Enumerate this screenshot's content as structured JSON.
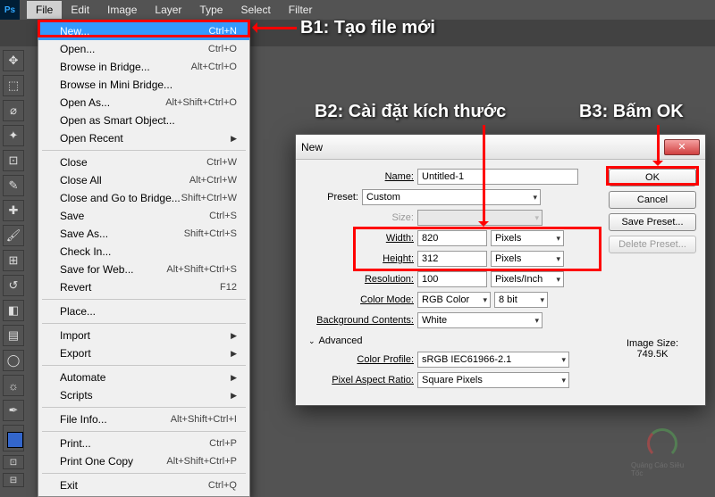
{
  "menubar": {
    "items": [
      "File",
      "Edit",
      "Image",
      "Layer",
      "Type",
      "Select",
      "Filter"
    ],
    "active_index": 0
  },
  "file_menu": {
    "groups": [
      [
        {
          "label": "New...",
          "shortcut": "Ctrl+N",
          "hl": true
        },
        {
          "label": "Open...",
          "shortcut": "Ctrl+O"
        },
        {
          "label": "Browse in Bridge...",
          "shortcut": "Alt+Ctrl+O"
        },
        {
          "label": "Browse in Mini Bridge..."
        },
        {
          "label": "Open As...",
          "shortcut": "Alt+Shift+Ctrl+O"
        },
        {
          "label": "Open as Smart Object..."
        },
        {
          "label": "Open Recent",
          "submenu": true
        }
      ],
      [
        {
          "label": "Close",
          "shortcut": "Ctrl+W"
        },
        {
          "label": "Close All",
          "shortcut": "Alt+Ctrl+W"
        },
        {
          "label": "Close and Go to Bridge...",
          "shortcut": "Shift+Ctrl+W"
        },
        {
          "label": "Save",
          "shortcut": "Ctrl+S"
        },
        {
          "label": "Save As...",
          "shortcut": "Shift+Ctrl+S"
        },
        {
          "label": "Check In..."
        },
        {
          "label": "Save for Web...",
          "shortcut": "Alt+Shift+Ctrl+S"
        },
        {
          "label": "Revert",
          "shortcut": "F12"
        }
      ],
      [
        {
          "label": "Place..."
        }
      ],
      [
        {
          "label": "Import",
          "submenu": true
        },
        {
          "label": "Export",
          "submenu": true
        }
      ],
      [
        {
          "label": "Automate",
          "submenu": true
        },
        {
          "label": "Scripts",
          "submenu": true
        }
      ],
      [
        {
          "label": "File Info...",
          "shortcut": "Alt+Shift+Ctrl+I"
        }
      ],
      [
        {
          "label": "Print...",
          "shortcut": "Ctrl+P"
        },
        {
          "label": "Print One Copy",
          "shortcut": "Alt+Shift+Ctrl+P"
        }
      ],
      [
        {
          "label": "Exit",
          "shortcut": "Ctrl+Q"
        }
      ]
    ]
  },
  "tools": [
    "move",
    "marquee",
    "lasso",
    "wand",
    "crop",
    "eyedrop",
    "heal",
    "brush",
    "stamp",
    "history",
    "eraser",
    "gradient",
    "blur",
    "dodge",
    "pen"
  ],
  "dialog": {
    "title": "New",
    "name_label": "Name:",
    "name_value": "Untitled-1",
    "preset_label": "Preset:",
    "preset_value": "Custom",
    "size_label": "Size:",
    "width_label": "Width:",
    "width_value": "820",
    "width_unit": "Pixels",
    "height_label": "Height:",
    "height_value": "312",
    "height_unit": "Pixels",
    "resolution_label": "Resolution:",
    "resolution_value": "100",
    "resolution_unit": "Pixels/Inch",
    "colormode_label": "Color Mode:",
    "colormode_value": "RGB Color",
    "colormode_depth": "8 bit",
    "bg_label": "Background Contents:",
    "bg_value": "White",
    "advanced_label": "Advanced",
    "profile_label": "Color Profile:",
    "profile_value": "sRGB IEC61966-2.1",
    "aspect_label": "Pixel Aspect Ratio:",
    "aspect_value": "Square Pixels",
    "ok": "OK",
    "cancel": "Cancel",
    "save_preset": "Save Preset...",
    "delete_preset": "Delete Preset...",
    "image_size_label": "Image Size:",
    "image_size_value": "749.5K"
  },
  "annotations": {
    "b1": "B1: Tạo file mới",
    "b2": "B2: Cài đặt kích thước",
    "b3": "B3: Bấm OK"
  },
  "watermark": "Quảng Cáo Siêu Tốc"
}
